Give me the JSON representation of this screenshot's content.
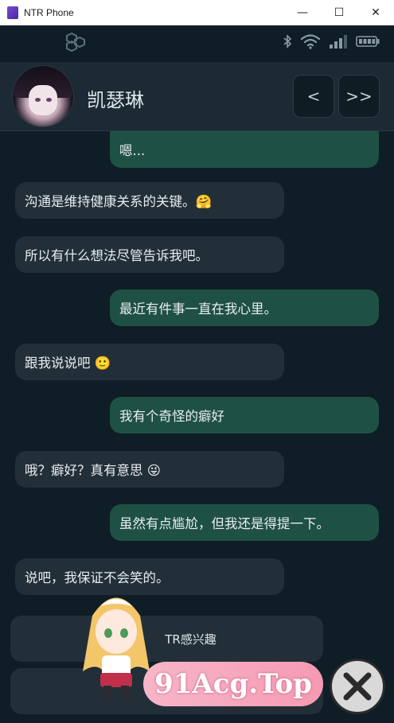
{
  "window": {
    "title": "NTR Phone",
    "minimize_glyph": "—",
    "maximize_glyph": "☐",
    "close_glyph": "✕"
  },
  "status": {
    "icons": [
      "cube-logo-icon",
      "bluetooth-icon",
      "wifi-icon",
      "signal-icon",
      "battery-icon"
    ]
  },
  "header": {
    "name": "凯瑟琳",
    "back_label": "<",
    "forward_label": ">>"
  },
  "messages": [
    {
      "side": "right",
      "text": "嗯..."
    },
    {
      "side": "left",
      "text": "沟通是维持健康关系的关键。🤗"
    },
    {
      "side": "left",
      "text": "所以有什么想法尽管告诉我吧。"
    },
    {
      "side": "right",
      "text": "最近有件事一直在我心里。"
    },
    {
      "side": "left",
      "text": "跟我说说吧 🙂"
    },
    {
      "side": "right",
      "text": "我有个奇怪的癖好"
    },
    {
      "side": "left",
      "text": "哦？癖好？真有意思 😜"
    },
    {
      "side": "right",
      "text": "虽然有点尴尬，但我还是得提一下。"
    },
    {
      "side": "left",
      "text": "说吧，我保证不会笑的。"
    }
  ],
  "choices": [
    {
      "text": "TR感兴趣"
    },
    {
      "text": ""
    }
  ],
  "watermark": {
    "text": "91Acg.Top"
  },
  "colors": {
    "background": "#0f1d26",
    "header": "#1b2a34",
    "bubble_left": "#232f38",
    "bubble_right": "#1e5144",
    "text": "#e9edef"
  }
}
